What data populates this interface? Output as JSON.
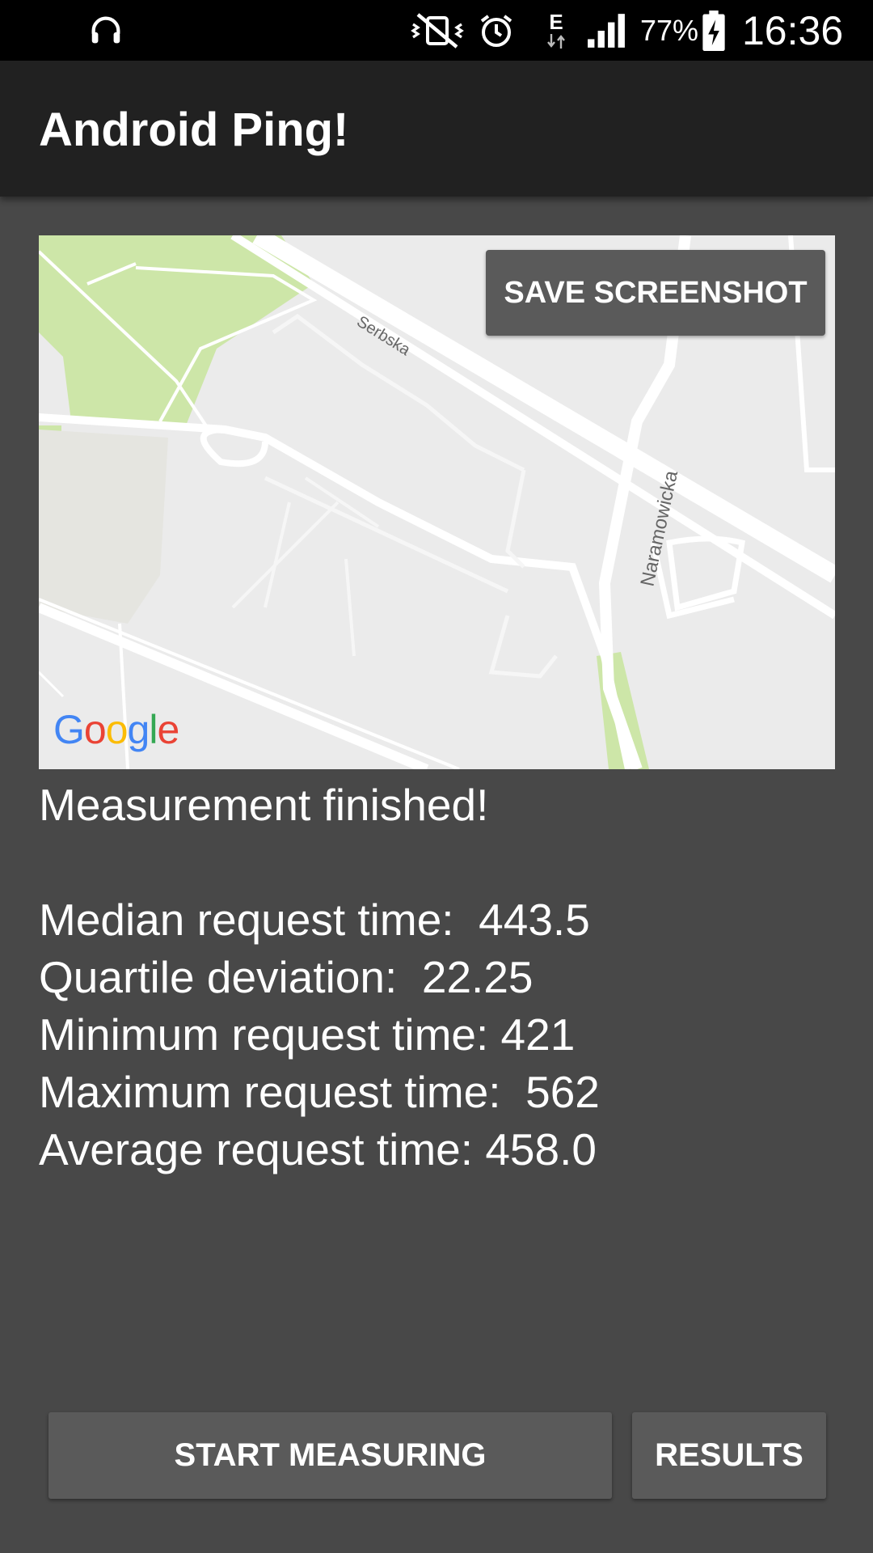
{
  "status_bar": {
    "battery_percent": "77%",
    "time": "16:36",
    "network_type": "E",
    "icons": [
      "headphones-icon",
      "mute-vibrate-icon",
      "alarm-icon",
      "data-arrows-icon",
      "signal-icon",
      "battery-charging-icon"
    ]
  },
  "app_bar": {
    "title": "Android Ping!"
  },
  "map": {
    "save_button_label": "SAVE SCREENSHOT",
    "street_labels": [
      "Serbska",
      "Naramowicka"
    ],
    "logo_text": [
      "G",
      "o",
      "o",
      "g",
      "l",
      "e"
    ],
    "colors": {
      "background": "#ebebeb",
      "park": "#cde6a8",
      "road": "#ffffff"
    }
  },
  "results": {
    "status": "Measurement finished!",
    "lines": [
      "Median request time:  443.5",
      "Quartile deviation:  22.25",
      "Minimum request time: 421",
      "Maximum request time:  562",
      "Average request time: 458.0"
    ]
  },
  "buttons": {
    "start_label": "START MEASURING",
    "results_label": "RESULTS"
  },
  "colors": {
    "background": "#484848",
    "app_bar": "#212121",
    "button": "#5a5a5a",
    "text": "#ffffff"
  }
}
